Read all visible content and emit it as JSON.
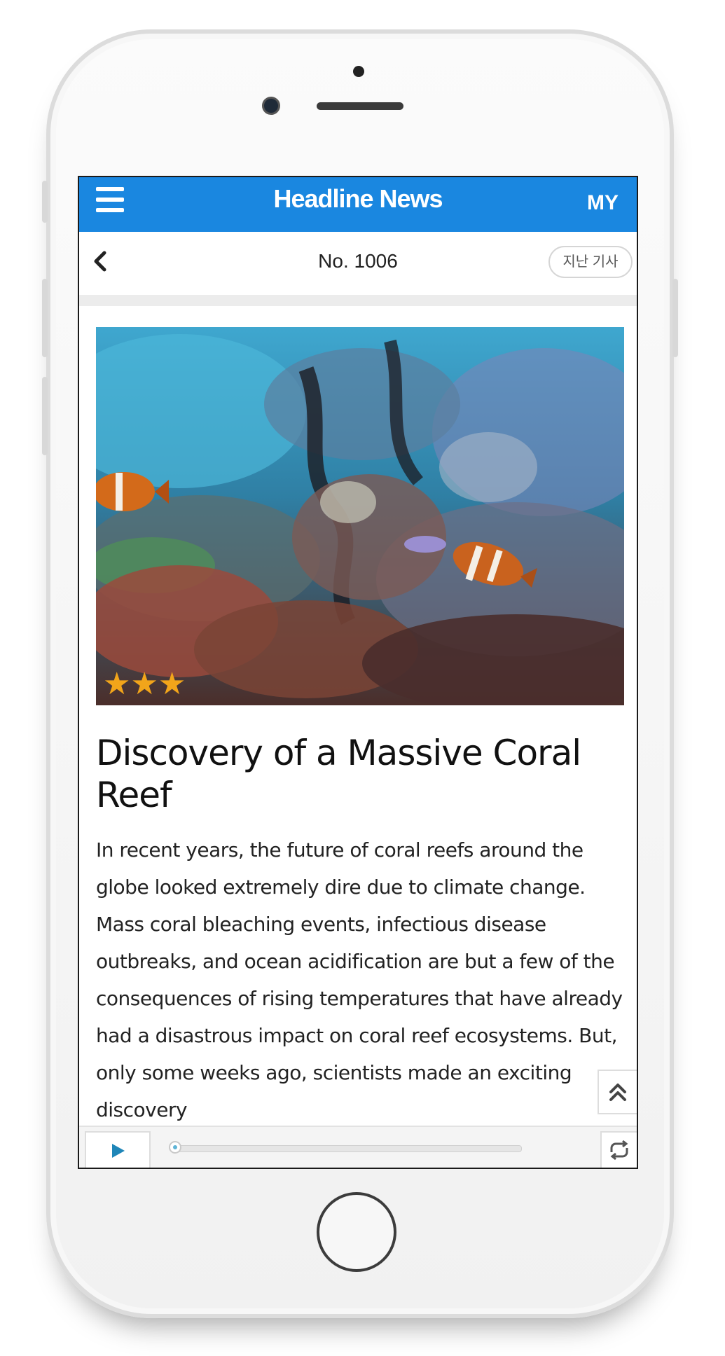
{
  "header": {
    "app_title": "Headline News",
    "my_label": "MY",
    "menu_icon": "hamburger-menu-icon"
  },
  "subheader": {
    "issue_number": "No. 1006",
    "past_articles_label": "지난 기사",
    "back_icon": "chevron-left-icon"
  },
  "article": {
    "image_alt": "coral reef with clownfish",
    "rating": {
      "value": 3,
      "max": 3
    },
    "title": "Discovery of a Massive Coral Reef",
    "body": "In recent years, the future of coral reefs around the globe looked extremely dire due to climate change. Mass coral bleaching events, infectious disease outbreaks, and ocean acidification are but a few of the consequences of rising temperatures that have already had a disastrous impact on coral reef ecosystems. But, only some weeks ago, scientists made an exciting discovery"
  },
  "player": {
    "play_icon": "play-icon",
    "repeat_icon": "repeat-icon",
    "progress": 0.0
  },
  "colors": {
    "accent": "#1a87e0",
    "star": "#f2a51a",
    "player_accent": "#5fb4d6"
  },
  "icons": {
    "scroll_top": "double-chevron-up-icon"
  }
}
